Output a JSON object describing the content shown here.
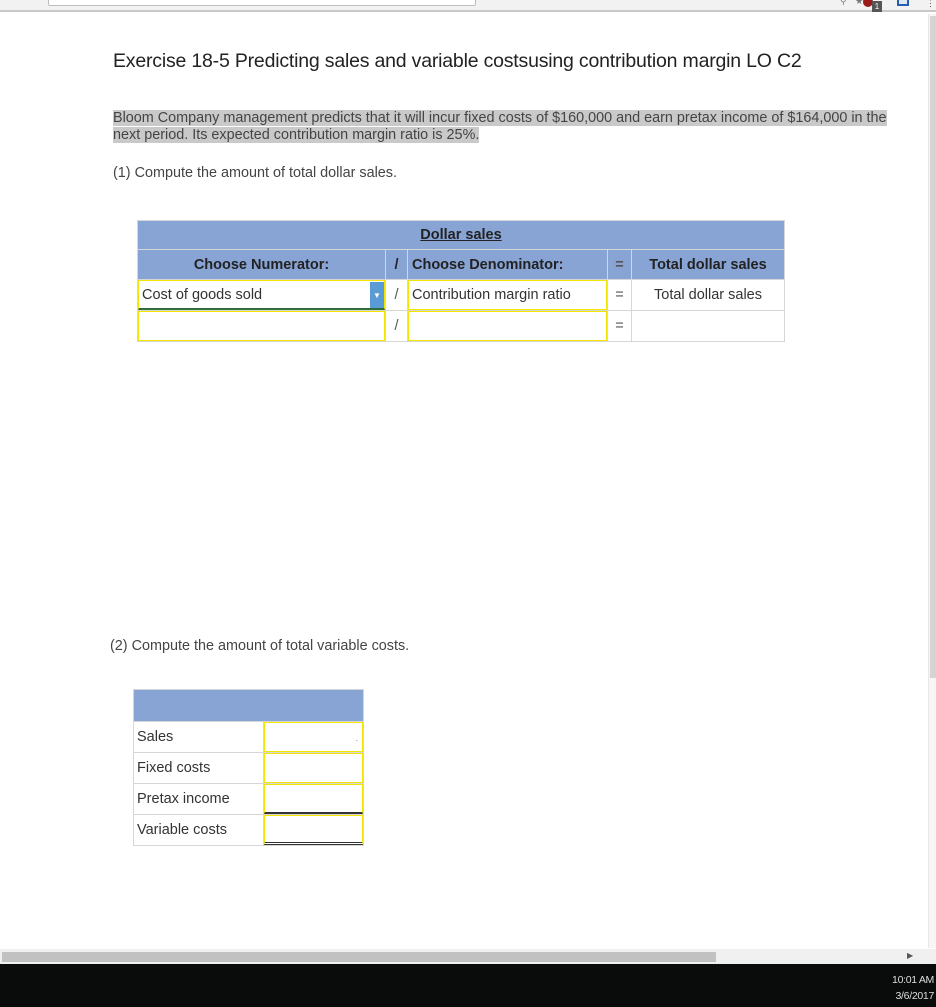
{
  "browser": {
    "extension_badge": "1",
    "icons": [
      "search-icon",
      "star-icon",
      "extension-red-icon",
      "extension-blue-icon",
      "menu-icon"
    ]
  },
  "exercise": {
    "title": "Exercise 18-5 Predicting sales and variable costsusing contribution margin LO C2",
    "intro": "Bloom Company management predicts that it will incur fixed costs of $160,000 and earn pretax income of $164,000 in the next period. Its expected contribution margin ratio is 25%.",
    "part1_prompt": "(1) Compute the amount of total dollar sales.",
    "part2_prompt": "(2) Compute the amount of total variable costs."
  },
  "table1": {
    "title": "Dollar sales",
    "headers": {
      "numerator": "Choose Numerator:",
      "divide": "/",
      "denominator": "Choose Denominator:",
      "equals": "=",
      "result": "Total dollar sales"
    },
    "rows": [
      {
        "numerator": "Cost of goods sold",
        "divide": "/",
        "denominator": "Contribution margin ratio",
        "equals": "=",
        "result": "Total dollar sales"
      },
      {
        "numerator": "",
        "divide": "/",
        "denominator": "",
        "equals": "=",
        "result": ""
      }
    ]
  },
  "table2": {
    "rows": [
      {
        "label": "Sales",
        "value": ""
      },
      {
        "label": "Fixed costs",
        "value": ""
      },
      {
        "label": "Pretax income",
        "value": ""
      },
      {
        "label": "Variable costs",
        "value": ""
      }
    ]
  },
  "taskbar": {
    "time": "10:01 AM",
    "date": "3/6/2017"
  },
  "colors": {
    "table_header": "#88a4d4",
    "input_border": "#f3e600",
    "dropdown_button": "#5b9bd5",
    "highlight": "#c9c9c9"
  }
}
